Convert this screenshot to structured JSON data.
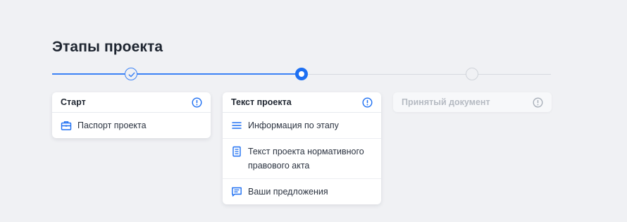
{
  "page": {
    "title": "Этапы проекта"
  },
  "colors": {
    "accent": "#1d6ff2",
    "line_done": "#3b82f6",
    "line_todo": "#d7dae0",
    "background": "#f0f1f4"
  },
  "stages": [
    {
      "title": "Старт",
      "status": "done",
      "items": [
        {
          "label": "Паспорт проекта",
          "icon": "briefcase-icon"
        }
      ]
    },
    {
      "title": "Текст проекта",
      "status": "current",
      "items": [
        {
          "label": "Информация по этапу",
          "icon": "list-lines-icon"
        },
        {
          "label": "Текст проекта нормативного правового акта",
          "icon": "document-icon"
        },
        {
          "label": "Ваши предложения",
          "icon": "comment-icon"
        }
      ]
    },
    {
      "title": "Принятый документ",
      "status": "future",
      "items": []
    }
  ]
}
